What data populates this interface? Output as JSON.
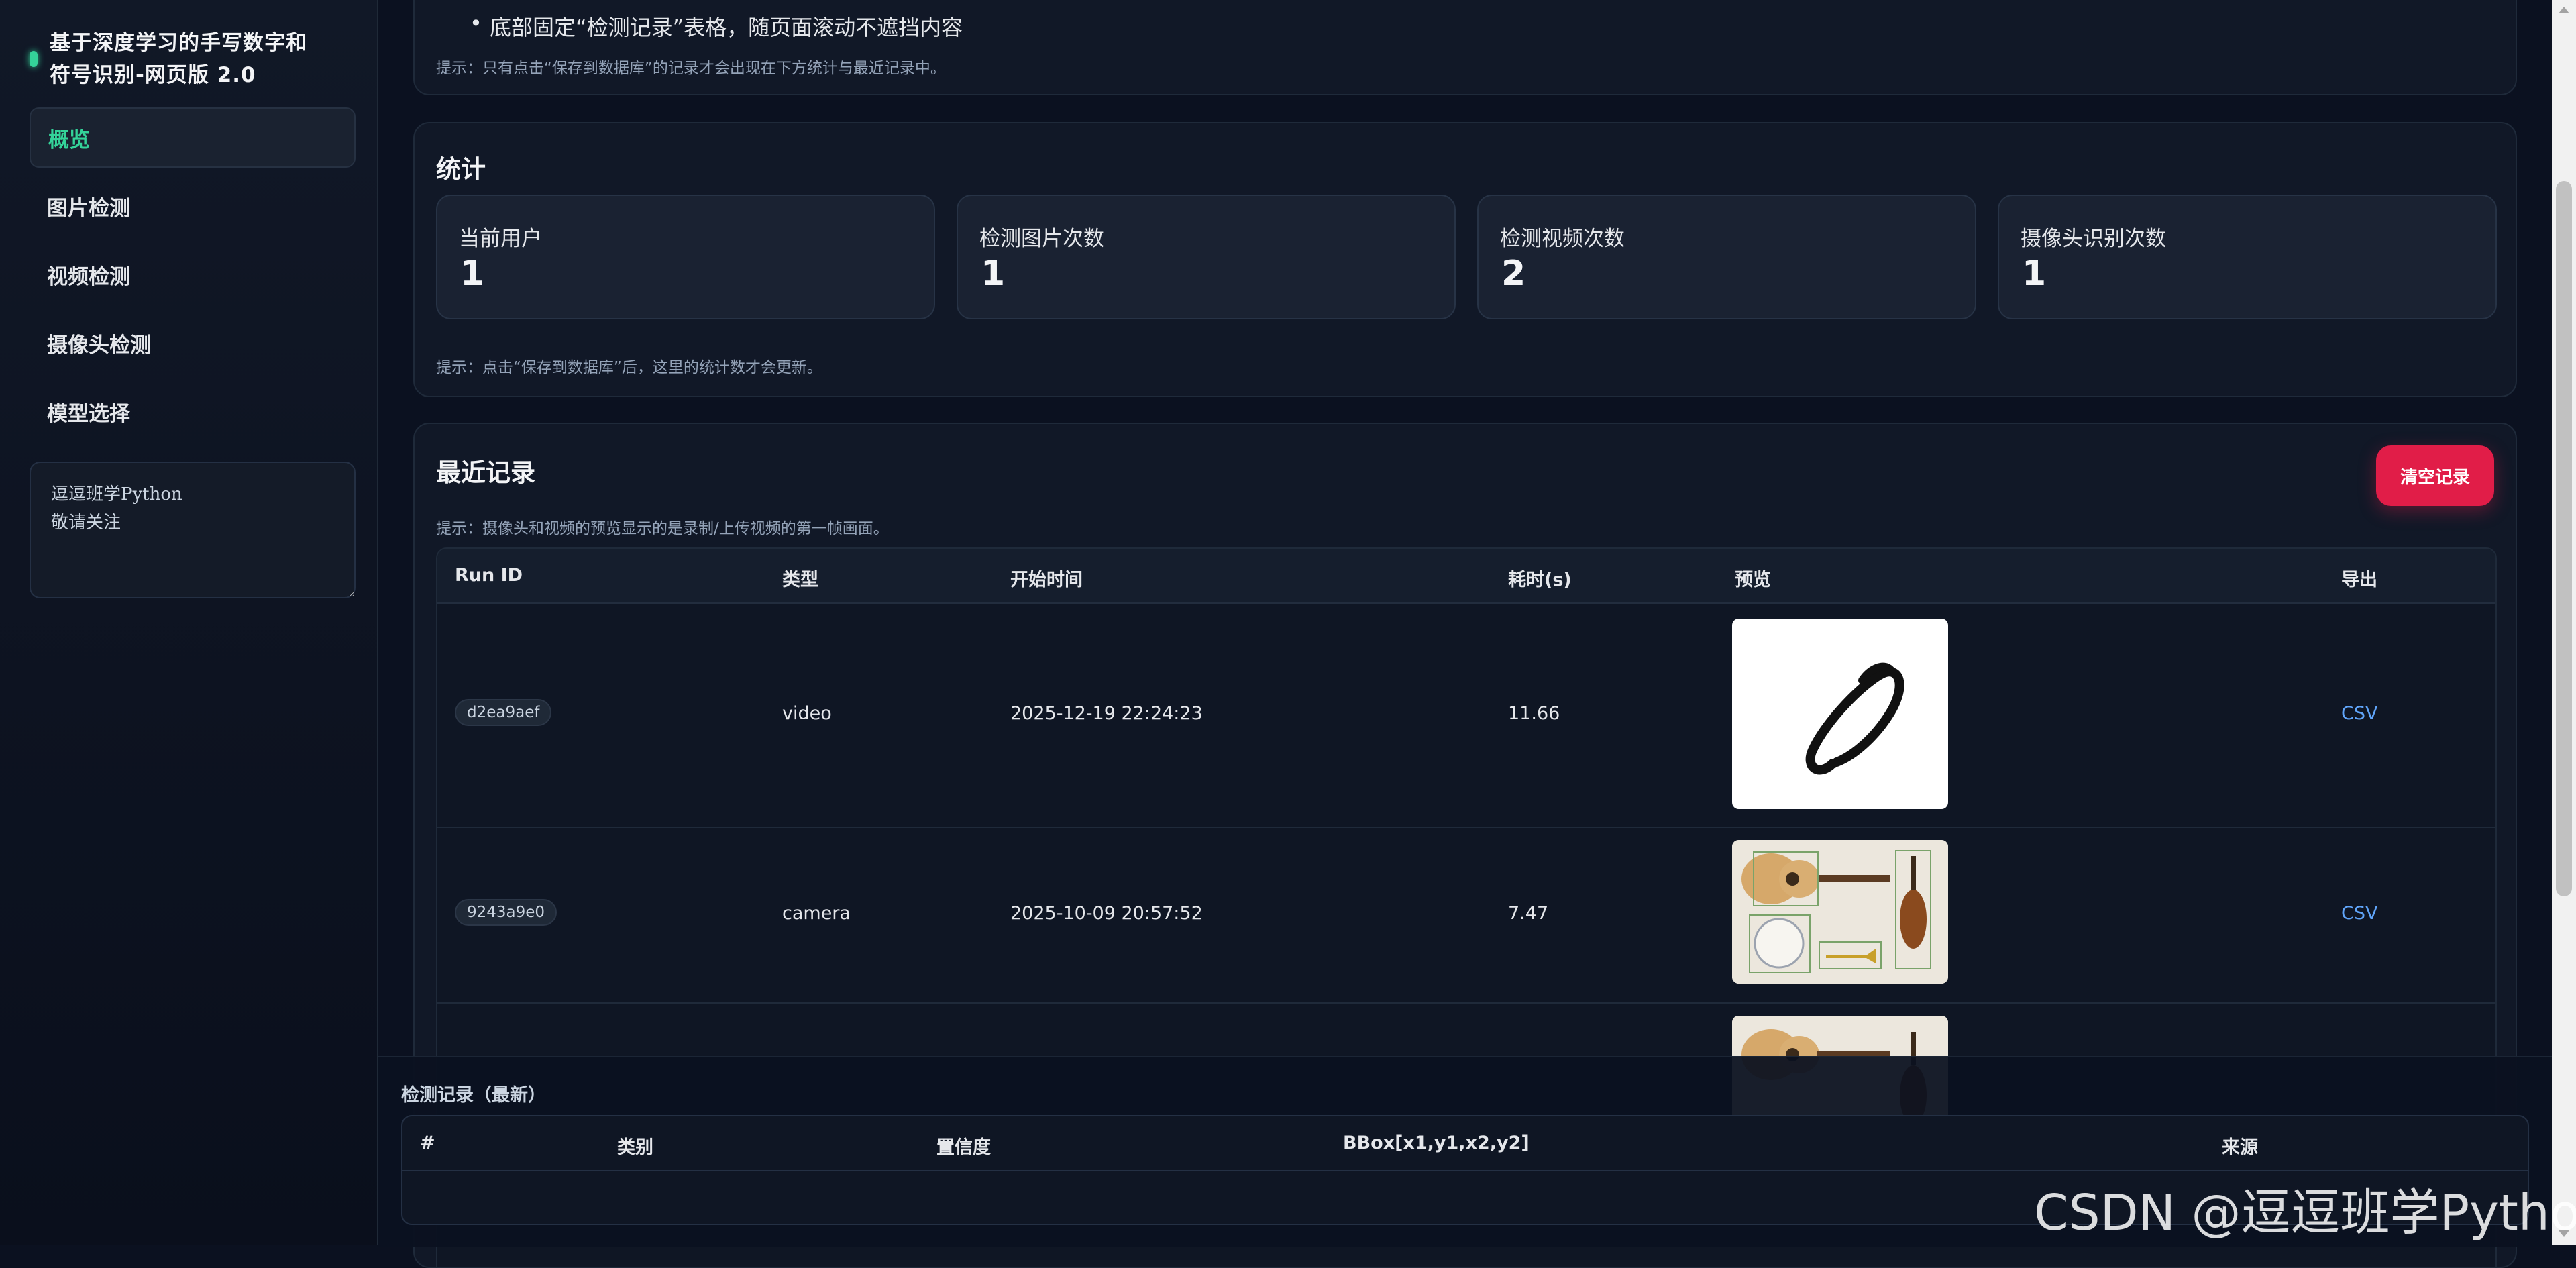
{
  "app": {
    "title": "基于深度学习的手写数字和符号识别-网页版 2.0",
    "title_line1": "基于深度学习的手写数字和",
    "title_line2": "符号识别-网页版 2.0",
    "accent": "#34d399"
  },
  "sidebar": {
    "items": [
      {
        "label": "概览",
        "active": true
      },
      {
        "label": "图片检测"
      },
      {
        "label": "视频检测"
      },
      {
        "label": "摄像头检测"
      },
      {
        "label": "模型选择"
      }
    ],
    "notes_value": "逗逗班学Python\n敬请关注"
  },
  "top_card": {
    "bullet": "底部固定“检测记录”表格，随页面滚动不遮挡内容",
    "tip": "提示：只有点击“保存到数据库”的记录才会出现在下方统计与最近记录中。"
  },
  "stats": {
    "title": "统计",
    "items": [
      {
        "label": "当前用户",
        "value": "1"
      },
      {
        "label": "检测图片次数",
        "value": "1"
      },
      {
        "label": "检测视频次数",
        "value": "2"
      },
      {
        "label": "摄像头识别次数",
        "value": "1"
      }
    ],
    "tip": "提示：点击“保存到数据库”后，这里的统计数才会更新。"
  },
  "recent": {
    "title": "最近记录",
    "clear_label": "清空记录",
    "clear_color": "#e11d48",
    "tip": "提示：摄像头和视频的预览显示的是录制/上传视频的第一帧画面。",
    "columns": [
      "Run ID",
      "类型",
      "开始时间",
      "耗时(s)",
      "预览",
      "导出"
    ],
    "rows": [
      {
        "run_id": "d2ea9aef",
        "type": "video",
        "start": "2025-12-19 22:24:23",
        "duration": "11.66",
        "export": "CSV",
        "preview": "handwritten-symbol"
      },
      {
        "run_id": "9243a9e0",
        "type": "camera",
        "start": "2025-10-09 20:57:52",
        "duration": "7.47",
        "export": "CSV",
        "preview": "instruments-photo"
      },
      {
        "run_id": "",
        "type": "",
        "start": "",
        "duration": "",
        "export": "",
        "preview": "instruments-photo"
      }
    ]
  },
  "dock": {
    "title": "检测记录（最新）",
    "columns": [
      "#",
      "类别",
      "置信度",
      "BBox[x1,y1,x2,y2]",
      "来源"
    ]
  },
  "watermark": "CSDN @逗逗班学Python"
}
